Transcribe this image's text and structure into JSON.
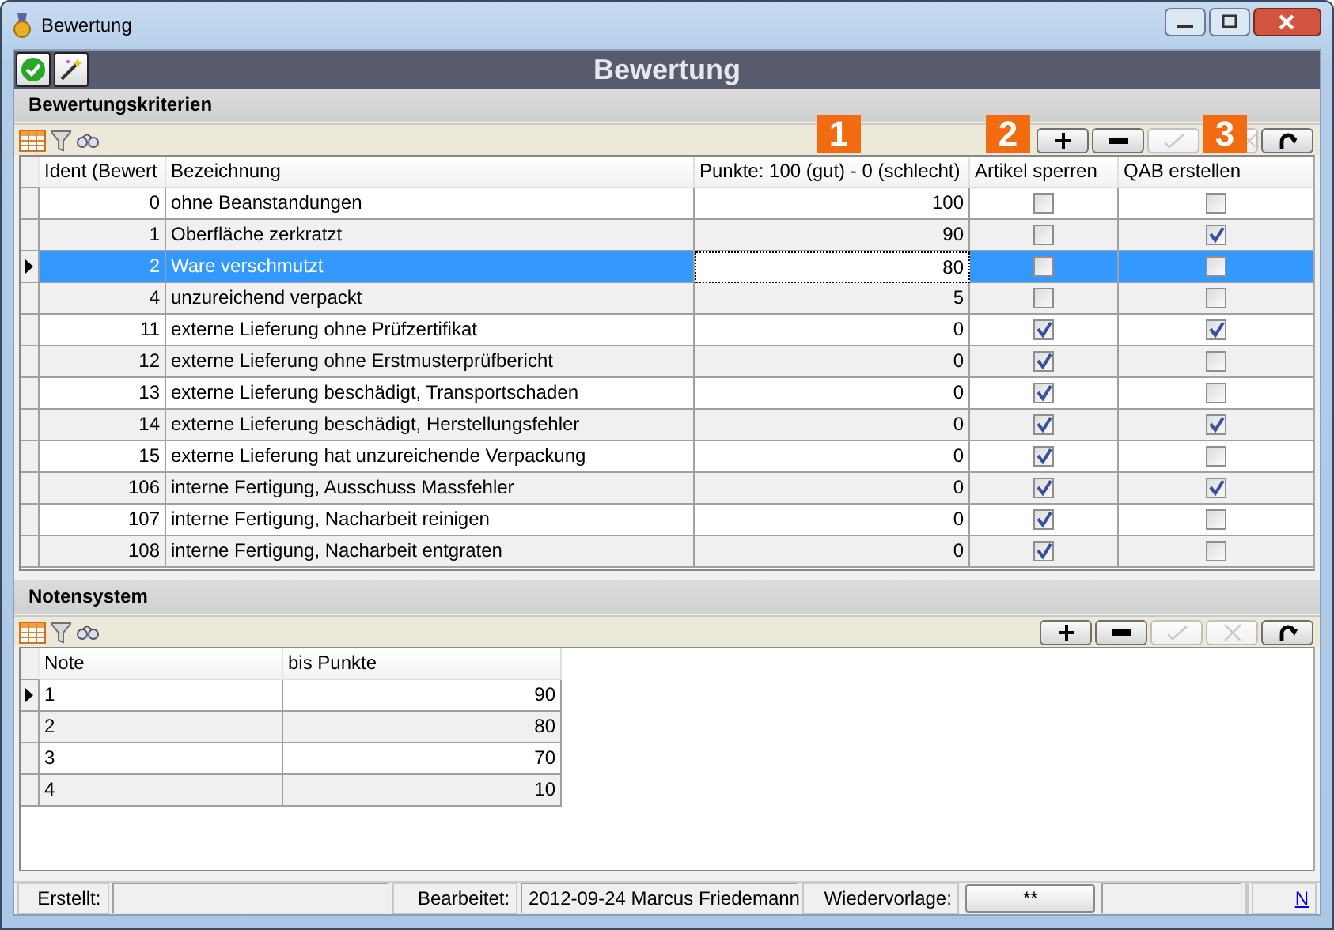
{
  "window": {
    "title": "Bewertung"
  },
  "header": {
    "title": "Bewertung"
  },
  "sections": [
    {
      "title": "Bewertungskriterien",
      "badges": [
        "1",
        "2",
        "3"
      ],
      "buttons": [
        {
          "kind": "add",
          "disabled": false
        },
        {
          "kind": "remove",
          "disabled": false
        },
        {
          "kind": "confirm",
          "disabled": true
        },
        {
          "kind": "cancel",
          "disabled": true
        },
        {
          "kind": "refresh",
          "disabled": false
        }
      ],
      "table": {
        "columns": [
          {
            "label": "Ident (Bewert",
            "kind": "number"
          },
          {
            "label": "Bezeichnung",
            "kind": "text"
          },
          {
            "label": "Punkte: 100 (gut) - 0 (schlecht)",
            "kind": "number"
          },
          {
            "label": "Artikel sperren",
            "kind": "check"
          },
          {
            "label": "QAB erstellen",
            "kind": "check"
          }
        ],
        "rows": [
          {
            "current": false,
            "selected": false,
            "cells": [
              "0",
              "ohne Beanstandungen",
              "100",
              false,
              false
            ]
          },
          {
            "current": false,
            "selected": false,
            "cells": [
              "1",
              "Oberfläche zerkratzt",
              "90",
              false,
              true
            ]
          },
          {
            "current": true,
            "selected": true,
            "cells": [
              "2",
              "Ware verschmutzt",
              "80",
              false,
              false
            ]
          },
          {
            "current": false,
            "selected": false,
            "cells": [
              "4",
              "unzureichend verpackt",
              "5",
              false,
              false
            ]
          },
          {
            "current": false,
            "selected": false,
            "cells": [
              "11",
              "externe Lieferung ohne Prüfzertifikat",
              "0",
              true,
              true
            ]
          },
          {
            "current": false,
            "selected": false,
            "cells": [
              "12",
              "externe Lieferung ohne Erstmusterprüfbericht",
              "0",
              true,
              false
            ]
          },
          {
            "current": false,
            "selected": false,
            "cells": [
              "13",
              "externe Lieferung beschädigt, Transportschaden",
              "0",
              true,
              false
            ]
          },
          {
            "current": false,
            "selected": false,
            "cells": [
              "14",
              "externe Lieferung beschädigt, Herstellungsfehler",
              "0",
              true,
              true
            ]
          },
          {
            "current": false,
            "selected": false,
            "cells": [
              "15",
              "externe Lieferung hat unzureichende Verpackung",
              "0",
              true,
              false
            ]
          },
          {
            "current": false,
            "selected": false,
            "cells": [
              "106",
              "interne Fertigung,  Ausschuss Massfehler",
              "0",
              true,
              true
            ]
          },
          {
            "current": false,
            "selected": false,
            "cells": [
              "107",
              "interne Fertigung, Nacharbeit reinigen",
              "0",
              true,
              false
            ]
          },
          {
            "current": false,
            "selected": false,
            "cells": [
              "108",
              "interne Fertigung, Nacharbeit entgraten",
              "0",
              true,
              false
            ]
          }
        ]
      }
    },
    {
      "title": "Notensystem",
      "buttons": [
        {
          "kind": "add",
          "disabled": false
        },
        {
          "kind": "remove",
          "disabled": false
        },
        {
          "kind": "confirm",
          "disabled": true
        },
        {
          "kind": "cancel",
          "disabled": true
        },
        {
          "kind": "refresh",
          "disabled": false
        }
      ],
      "table": {
        "columns": [
          {
            "label": "Note",
            "kind": "text"
          },
          {
            "label": "bis Punkte",
            "kind": "number"
          }
        ],
        "rows": [
          {
            "current": true,
            "selected": false,
            "cells": [
              "1",
              "90"
            ]
          },
          {
            "current": false,
            "selected": false,
            "cells": [
              "2",
              "80"
            ]
          },
          {
            "current": false,
            "selected": false,
            "cells": [
              "3",
              "70"
            ]
          },
          {
            "current": false,
            "selected": false,
            "cells": [
              "4",
              "10"
            ]
          }
        ]
      }
    }
  ],
  "status_bar": [
    {
      "kind": "label",
      "text": "Erstellt:"
    },
    {
      "kind": "field"
    },
    {
      "kind": "label",
      "text": "Bearbeitet:"
    },
    {
      "kind": "field",
      "text": "2012-09-24  Marcus Friedemann"
    },
    {
      "kind": "label",
      "text": "Wiedervorlage:"
    },
    {
      "kind": "button",
      "text": "**"
    },
    {
      "kind": "field"
    },
    {
      "kind": "link",
      "text": "N"
    }
  ]
}
